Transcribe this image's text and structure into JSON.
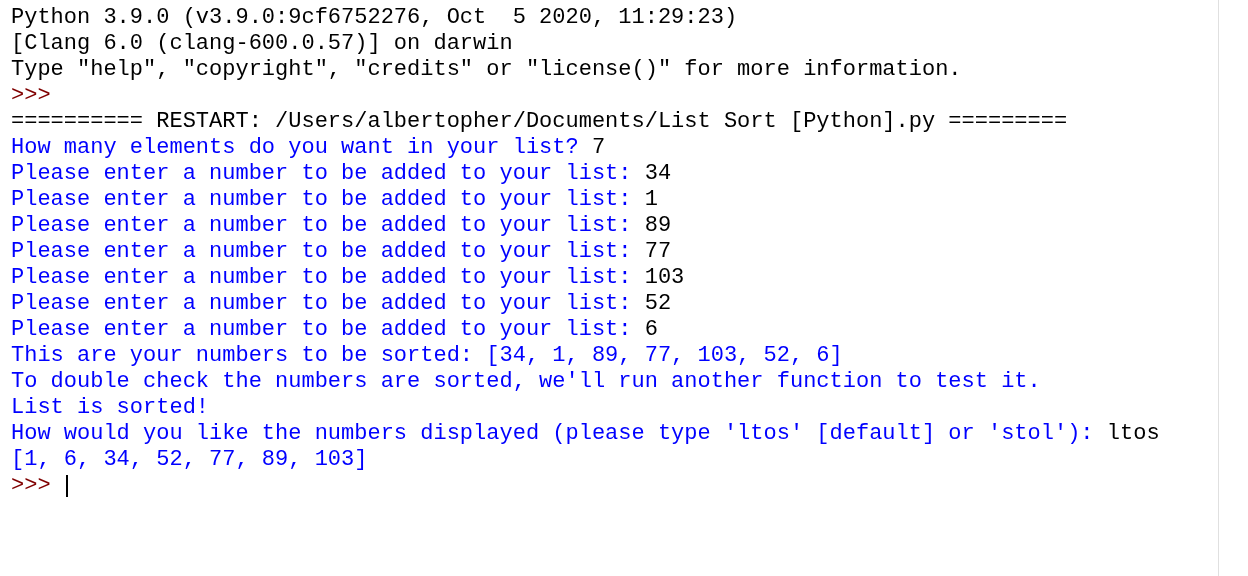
{
  "shell": {
    "lines": [
      {
        "segments": [
          {
            "kind": "output",
            "text": "Python 3.9.0 (v3.9.0:9cf6752276, Oct  5 2020, 11:29:23)"
          }
        ]
      },
      {
        "segments": [
          {
            "kind": "output",
            "text": "[Clang 6.0 (clang-600.0.57)] on darwin"
          }
        ]
      },
      {
        "segments": [
          {
            "kind": "output",
            "text": "Type \"help\", \"copyright\", \"credits\" or \"license()\" for more information."
          }
        ]
      },
      {
        "segments": [
          {
            "kind": "prompt",
            "text": ">>>"
          }
        ]
      },
      {
        "segments": [
          {
            "kind": "output",
            "text": "========== RESTART: /Users/albertopher/Documents/List Sort [Python].py ========="
          }
        ]
      },
      {
        "segments": [
          {
            "kind": "stdout",
            "text": "How many elements do you want in your list? "
          },
          {
            "kind": "input",
            "text": "7"
          }
        ]
      },
      {
        "segments": [
          {
            "kind": "stdout",
            "text": "Please enter a number to be added to your list: "
          },
          {
            "kind": "input",
            "text": "34"
          }
        ]
      },
      {
        "segments": [
          {
            "kind": "stdout",
            "text": "Please enter a number to be added to your list: "
          },
          {
            "kind": "input",
            "text": "1"
          }
        ]
      },
      {
        "segments": [
          {
            "kind": "stdout",
            "text": "Please enter a number to be added to your list: "
          },
          {
            "kind": "input",
            "text": "89"
          }
        ]
      },
      {
        "segments": [
          {
            "kind": "stdout",
            "text": "Please enter a number to be added to your list: "
          },
          {
            "kind": "input",
            "text": "77"
          }
        ]
      },
      {
        "segments": [
          {
            "kind": "stdout",
            "text": "Please enter a number to be added to your list: "
          },
          {
            "kind": "input",
            "text": "103"
          }
        ]
      },
      {
        "segments": [
          {
            "kind": "stdout",
            "text": "Please enter a number to be added to your list: "
          },
          {
            "kind": "input",
            "text": "52"
          }
        ]
      },
      {
        "segments": [
          {
            "kind": "stdout",
            "text": "Please enter a number to be added to your list: "
          },
          {
            "kind": "input",
            "text": "6"
          }
        ]
      },
      {
        "segments": [
          {
            "kind": "stdout",
            "text": "This are your numbers to be sorted: [34, 1, 89, 77, 103, 52, 6]"
          }
        ]
      },
      {
        "segments": [
          {
            "kind": "stdout",
            "text": "To double check the numbers are sorted, we'll run another function to test it."
          }
        ]
      },
      {
        "segments": [
          {
            "kind": "stdout",
            "text": "List is sorted!"
          }
        ]
      },
      {
        "segments": [
          {
            "kind": "stdout",
            "text": "How would you like the numbers displayed (please type 'ltos' [default] or 'stol'): "
          },
          {
            "kind": "input",
            "text": "ltos"
          }
        ]
      },
      {
        "segments": [
          {
            "kind": "stdout",
            "text": "[1, 6, 34, 52, 77, 89, 103]"
          }
        ]
      },
      {
        "segments": [
          {
            "kind": "prompt",
            "text": ">>>"
          }
        ],
        "cursor": true
      }
    ]
  }
}
